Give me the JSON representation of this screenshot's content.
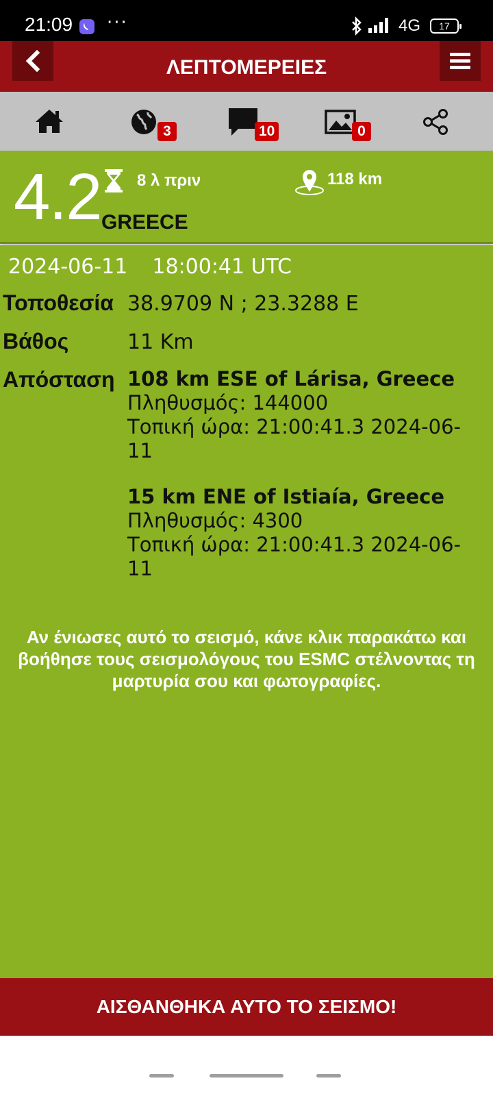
{
  "status_bar": {
    "time": "21:09",
    "dots": "···",
    "network": "4G",
    "battery": "17",
    "icons": [
      "viber-icon",
      "bluetooth-icon",
      "signal-icon"
    ]
  },
  "app_bar": {
    "title": "ΛΕΠΤΟΜΕΡΕΙΕΣ",
    "back_icon": "chevron-left-icon",
    "menu_icon": "hamburger-menu-icon"
  },
  "toolbar": {
    "home_icon": "home-icon",
    "globe_badge": "3",
    "comments_badge": "10",
    "pictures_badge": "0",
    "share_icon": "share-icon"
  },
  "quake": {
    "magnitude": "4.2",
    "time_ago": "8 λ πριν",
    "distance": "118 km",
    "region": "GREECE",
    "date": "2024-06-11",
    "time_utc": "18:00:41 UTC"
  },
  "details": {
    "location_label": "Τοποθεσία",
    "location_value": "38.9709 N ; 23.3288 E",
    "depth_label": "Βάθος",
    "depth_value": "11 Km",
    "distance_label": "Απόσταση",
    "places": [
      {
        "name": "108 km ESE of Lárisa, Greece",
        "population": "Πληθυσμός: 144000",
        "local_time": "Τοπική ώρα: 21:00:41.3 2024-06-11"
      },
      {
        "name": "15 km ENE of Istiaía, Greece",
        "population": "Πληθυσμός: 4300",
        "local_time": "Τοπική ώρα: 21:00:41.3 2024-06-11"
      }
    ]
  },
  "felt": {
    "message": "Αν ένιωσες αυτό το σεισμό, κάνε κλικ παρακάτω και βοήθησε τους σεισμολόγους του ESMC στέλνοντας τη μαρτυρία σου και φωτογραφίες.",
    "button_label": "ΑΙΣΘΑΝΘΗΚΑ ΑΥΤΟ ΤΟ ΣΕΙΣΜΟ!"
  },
  "colors": {
    "brand_red": "#991015",
    "dark_red": "#6b0a0d",
    "green": "#8ab222",
    "badge_red": "#cc0000",
    "toolbar_grey": "#c2c2c2"
  }
}
